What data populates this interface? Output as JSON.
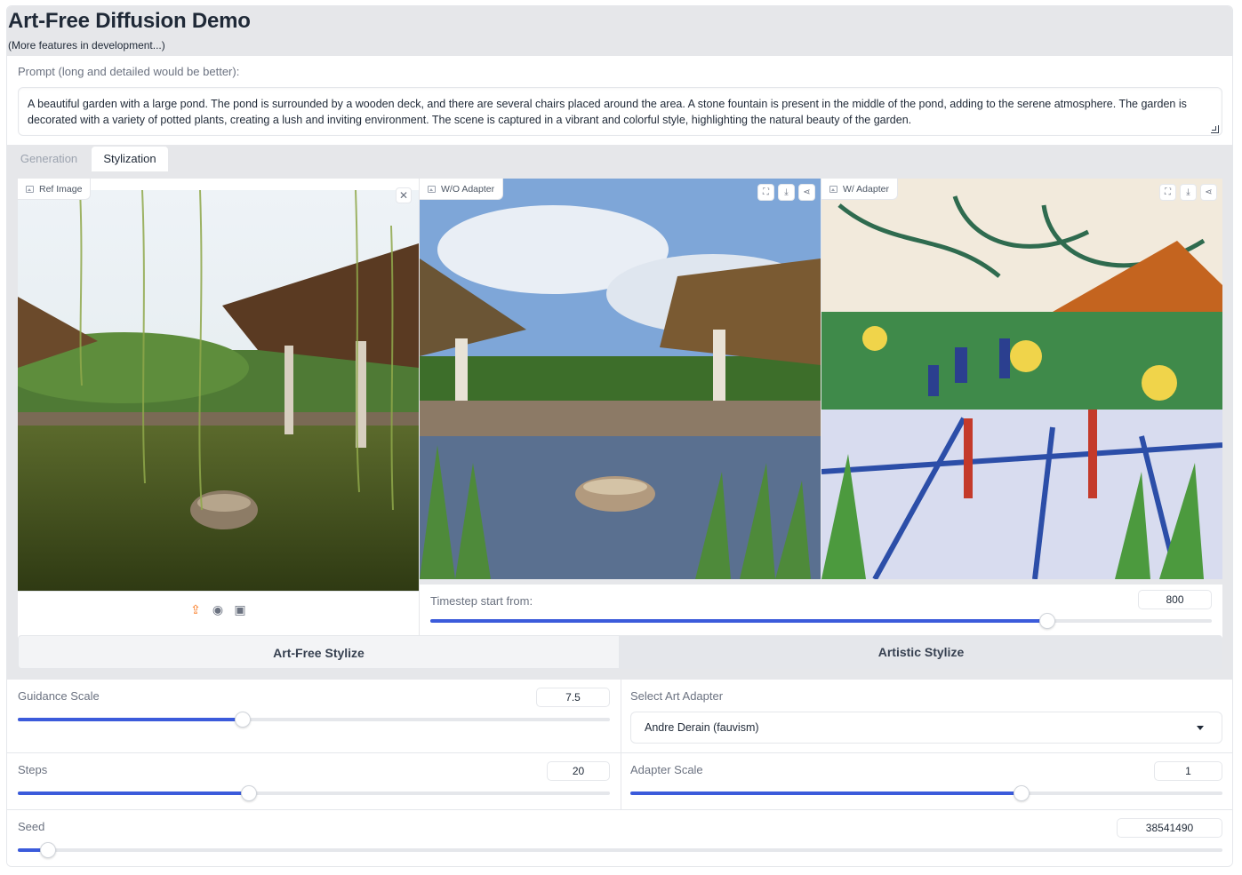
{
  "header": {
    "title": "Art-Free Diffusion Demo",
    "subtitle": "(More features in development...)"
  },
  "prompt": {
    "label": "Prompt (long and detailed would be better):",
    "value": "A beautiful garden with a large pond. The pond is surrounded by a wooden deck, and there are several chairs placed around the area. A stone fountain is present in the middle of the pond, adding to the serene atmosphere. The garden is decorated with a variety of potted plants, creating a lush and inviting environment. The scene is captured in a vibrant and colorful style, highlighting the natural beauty of the garden."
  },
  "tabs": [
    {
      "label": "Generation",
      "active": false
    },
    {
      "label": "Stylization",
      "active": true
    }
  ],
  "panels": {
    "ref": {
      "label": "Ref Image"
    },
    "without": {
      "label": "W/O Adapter"
    },
    "with": {
      "label": "W/ Adapter"
    }
  },
  "timestep": {
    "label": "Timestep start from:",
    "value": "800",
    "fraction": 0.79
  },
  "buttons": {
    "art_free": "Art-Free Stylize",
    "artistic": "Artistic Stylize"
  },
  "guidance": {
    "label": "Guidance Scale",
    "value": "7.5",
    "fraction": 0.38
  },
  "adapter_select": {
    "label": "Select Art Adapter",
    "value": "Andre Derain (fauvism)"
  },
  "steps": {
    "label": "Steps",
    "value": "20",
    "fraction": 0.39
  },
  "adapter_scale": {
    "label": "Adapter Scale",
    "value": "1",
    "fraction": 0.66
  },
  "seed": {
    "label": "Seed",
    "value": "38541490",
    "fraction": 0.025
  },
  "icons": [
    "image-icon",
    "close-icon",
    "upload-icon",
    "webcam-icon",
    "clipboard-icon",
    "fullscreen-icon",
    "download-icon",
    "share-icon",
    "chevron-down-icon"
  ],
  "colors": {
    "accent": "#3b5bdb",
    "upload": "#f97316",
    "panel_bg": "#e6e7ea"
  }
}
